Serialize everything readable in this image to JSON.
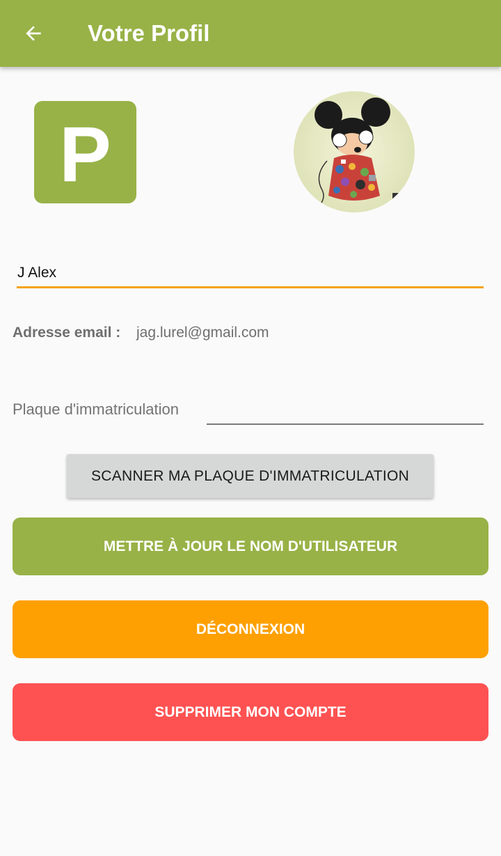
{
  "header": {
    "title": "Votre Profil",
    "back_icon": "arrow-left-icon"
  },
  "logo": {
    "letter": "P",
    "color": "#98b247"
  },
  "profile": {
    "username_value": "J Alex",
    "email_label": "Adresse email :",
    "email_value": "jag.lurel@gmail.com",
    "plate_label": "Plaque d'immatriculation",
    "plate_value": ""
  },
  "buttons": {
    "scan": "SCANNER MA PLAQUE D'IMMATRICULATION",
    "update": "METTRE À JOUR LE NOM D'UTILISATEUR",
    "logout": "DÉCONNEXION",
    "delete": "SUPPRIMER MON COMPTE"
  },
  "colors": {
    "primary": "#98b247",
    "accent": "#f7a21d",
    "logout": "#fea002",
    "danger": "#fe5252"
  }
}
